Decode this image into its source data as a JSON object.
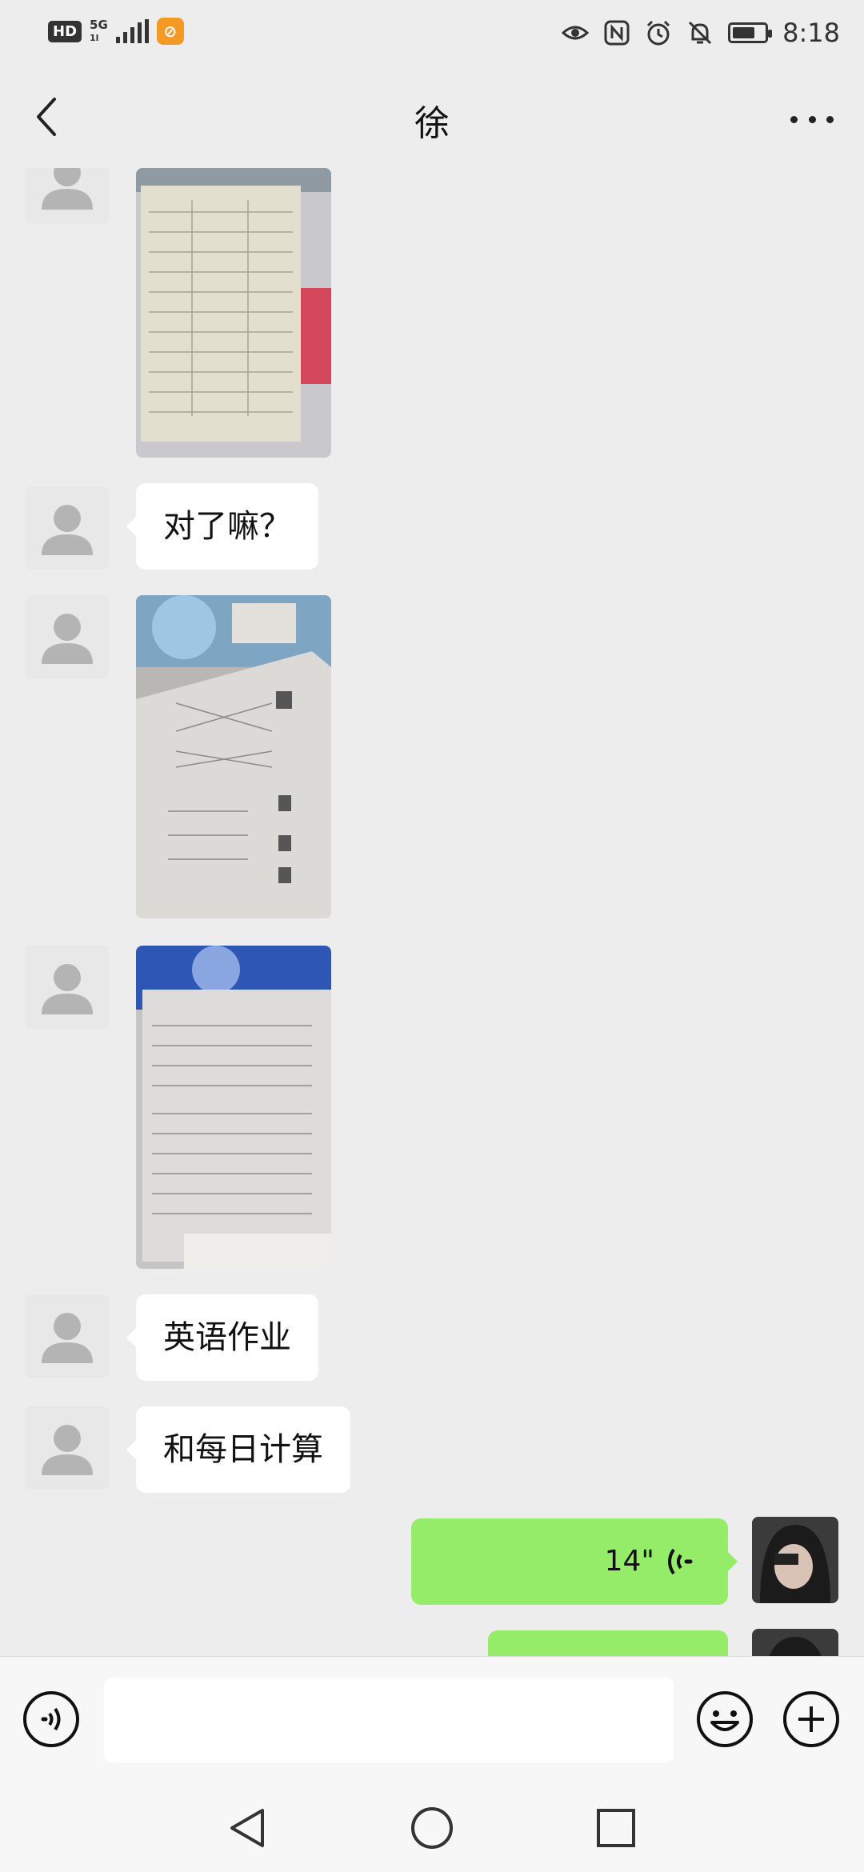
{
  "status_bar": {
    "hd": "HD",
    "network": "5G",
    "network_sub": "1l",
    "app_badge_glyph": "⊘",
    "icons": [
      "eye-icon",
      "nfc-icon",
      "alarm-icon",
      "bell-off-icon"
    ],
    "battery_level": 0.7,
    "time": "8:18"
  },
  "header": {
    "title": "徐",
    "back_icon": "chevron-left-icon",
    "more_icon": "more-dots-icon"
  },
  "messages": [
    {
      "side": "left",
      "type": "image",
      "description_icon": "photo-worksheet"
    },
    {
      "side": "left",
      "type": "text",
      "text": "对了嘛？"
    },
    {
      "side": "left",
      "type": "image",
      "description_icon": "photo-worksheet"
    },
    {
      "side": "left",
      "type": "image",
      "description_icon": "photo-worksheet"
    },
    {
      "side": "left",
      "type": "text",
      "text": "英语作业"
    },
    {
      "side": "left",
      "type": "text",
      "text": "和每日计算"
    },
    {
      "side": "right",
      "type": "voice",
      "duration": "14\""
    },
    {
      "side": "right",
      "type": "voice",
      "duration": ""
    }
  ],
  "input_bar": {
    "voice_icon": "voice-mode-icon",
    "input_value": "",
    "emoji_icon": "emoji-icon",
    "plus_icon": "plus-icon"
  },
  "nav_bar": {
    "icons": [
      "nav-back-icon",
      "nav-home-icon",
      "nav-recent-icon"
    ]
  },
  "colors": {
    "background": "#ededed",
    "bubble_self": "#95ec69",
    "bubble_other": "#ffffff",
    "app_badge": "#f39a24"
  }
}
